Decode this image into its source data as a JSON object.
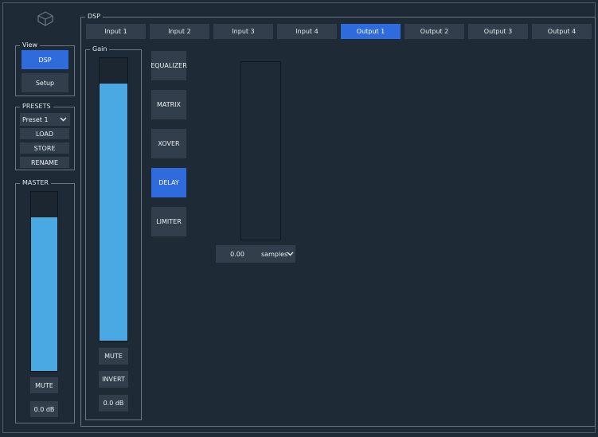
{
  "colors": {
    "background": "#1e2a36",
    "button": "#323e4b",
    "accent": "#2f6bdc",
    "meter_fill": "#4aa8e2"
  },
  "logo": {
    "icon": "device-logo-icon"
  },
  "view": {
    "label": "View",
    "dsp_label": "DSP",
    "setup_label": "Setup"
  },
  "presets": {
    "label": "PRESETS",
    "selected": "Preset 1",
    "load_label": "LOAD",
    "store_label": "STORE",
    "rename_label": "RENAME"
  },
  "master": {
    "label": "MASTER",
    "level_fraction": 0.86,
    "mute_label": "MUTE",
    "gain_value": "0.0 dB"
  },
  "dsp": {
    "label": "DSP",
    "tabs": [
      {
        "label": "Input 1"
      },
      {
        "label": "Input 2"
      },
      {
        "label": "Input 3"
      },
      {
        "label": "Input 4"
      },
      {
        "label": "Output 1"
      },
      {
        "label": "Output 2"
      },
      {
        "label": "Output 3"
      },
      {
        "label": "Output 4"
      }
    ],
    "active_tab": "Output 1"
  },
  "gain": {
    "label": "Gain",
    "level_fraction": 0.91,
    "mute_label": "MUTE",
    "invert_label": "INVERT",
    "gain_value": "0.0 dB"
  },
  "modules": [
    {
      "label": "EQUALIZER"
    },
    {
      "label": "MATRIX"
    },
    {
      "label": "XOVER"
    },
    {
      "label": "DELAY"
    },
    {
      "label": "LIMITER"
    }
  ],
  "active_module": "DELAY",
  "delay": {
    "level_fraction": 0.0,
    "value": "0.00",
    "unit": "samples"
  }
}
